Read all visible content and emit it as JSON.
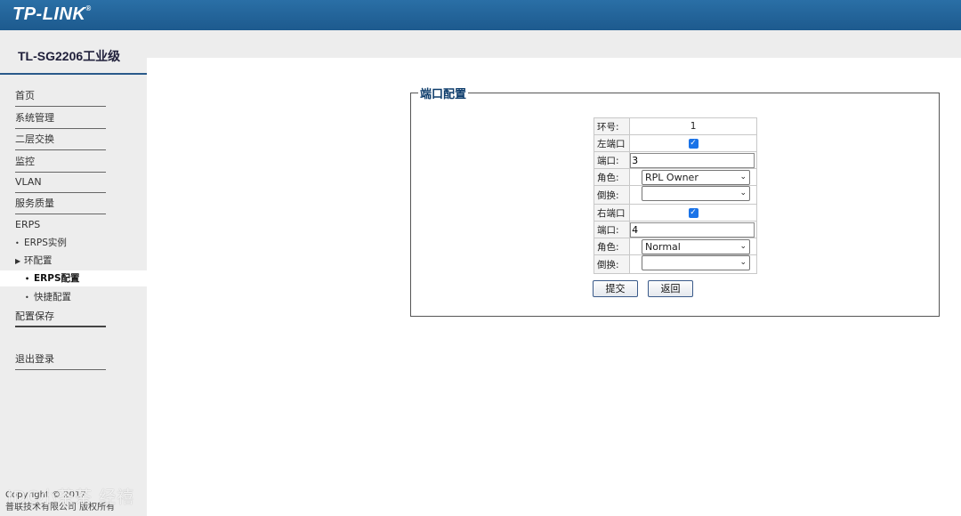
{
  "header": {
    "logo": "TP-LINK",
    "logo_mark": "®"
  },
  "sidebar": {
    "model": "TL-SG2206工业级",
    "items": [
      {
        "label": "首页"
      },
      {
        "label": "系统管理"
      },
      {
        "label": "二层交换"
      },
      {
        "label": "监控"
      },
      {
        "label": "VLAN"
      },
      {
        "label": "服务质量"
      },
      {
        "label": "ERPS"
      }
    ],
    "sub_items": [
      {
        "bullet": "•",
        "label": "ERPS实例"
      },
      {
        "bullet": "▶",
        "label": "环配置"
      },
      {
        "bullet": "•",
        "label": "ERPS配置"
      },
      {
        "bullet": "•",
        "label": "快捷配置"
      }
    ],
    "save": "配置保存",
    "logout": "退出登录",
    "copyright_line1": "Copyright © 2017",
    "copyright_line2": "普联技术有限公司 版权所有",
    "watermark": "iDC小茶茶 经禧"
  },
  "form": {
    "legend": "端口配置",
    "ring_label": "环号:",
    "ring_value": "1",
    "left_port_label": "左端口",
    "left_port_checked": true,
    "left_port_field_label": "端口:",
    "left_port_value": "3",
    "left_role_label": "角色:",
    "left_role_value": "RPL Owner",
    "left_revert_label": "倒换:",
    "left_revert_value": "",
    "right_port_label": "右端口",
    "right_port_checked": true,
    "right_port_field_label": "端口:",
    "right_port_value": "4",
    "right_role_label": "角色:",
    "right_role_value": "Normal",
    "right_revert_label": "倒换:",
    "right_revert_value": "",
    "submit_label": "提交",
    "back_label": "返回"
  }
}
